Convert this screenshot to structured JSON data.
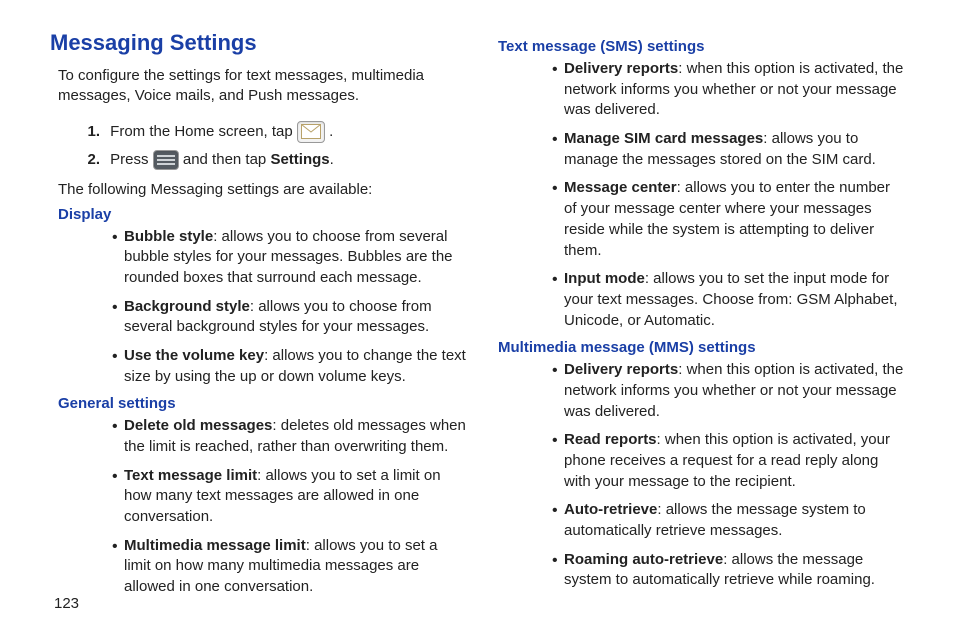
{
  "title": "Messaging Settings",
  "intro": "To configure the settings for text messages, multimedia messages, Voice mails, and Push messages.",
  "step1": {
    "num": "1.",
    "pre": "From the Home screen, tap ",
    "post": "."
  },
  "step2": {
    "num": "2.",
    "pre": "Press ",
    "mid": " and then tap ",
    "bold": "Settings",
    "post": "."
  },
  "available": "The following Messaging settings are available:",
  "display_heading": "Display",
  "display": [
    {
      "term": "Bubble style",
      "desc": ": allows you to choose from several bubble styles for your messages. Bubbles are the rounded boxes that surround each message."
    },
    {
      "term": "Background style",
      "desc": ": allows you to choose from several background styles for your messages."
    },
    {
      "term": "Use the volume key",
      "desc": ": allows you to change the text size by using the up or down volume keys."
    }
  ],
  "general_heading": "General settings",
  "general": [
    {
      "term": "Delete old messages",
      "desc": ": deletes old messages when the limit is reached, rather than overwriting them."
    },
    {
      "term": "Text message limit",
      "desc": ": allows you to set a limit on how many text messages are allowed in one conversation."
    },
    {
      "term": "Multimedia message limit",
      "desc": ": allows you to set a limit on how many multimedia messages are allowed in one conversation."
    }
  ],
  "sms_heading": "Text message (SMS) settings",
  "sms": [
    {
      "term": "Delivery reports",
      "desc": ": when this option is activated, the network informs you whether or not your message was delivered."
    },
    {
      "term": "Manage SIM card messages",
      "desc": ": allows you to manage the messages stored on the SIM card."
    },
    {
      "term": "Message center",
      "desc": ": allows you to enter the number of your message center where your messages reside while the system is attempting to deliver them."
    },
    {
      "term": "Input mode",
      "desc": ": allows you to set the input mode for your text messages. Choose from: GSM Alphabet, Unicode, or Automatic."
    }
  ],
  "mms_heading": "Multimedia message (MMS) settings",
  "mms": [
    {
      "term": "Delivery reports",
      "desc": ": when this option is activated, the network informs you whether or not your message was delivered."
    },
    {
      "term": "Read reports",
      "desc": ": when this option is activated, your phone receives a request for a read reply along with your message to the recipient."
    },
    {
      "term": "Auto-retrieve",
      "desc": ": allows the message system to automatically retrieve messages."
    },
    {
      "term": "Roaming auto-retrieve",
      "desc": ": allows the message system to automatically retrieve while roaming."
    }
  ],
  "page_number": "123"
}
